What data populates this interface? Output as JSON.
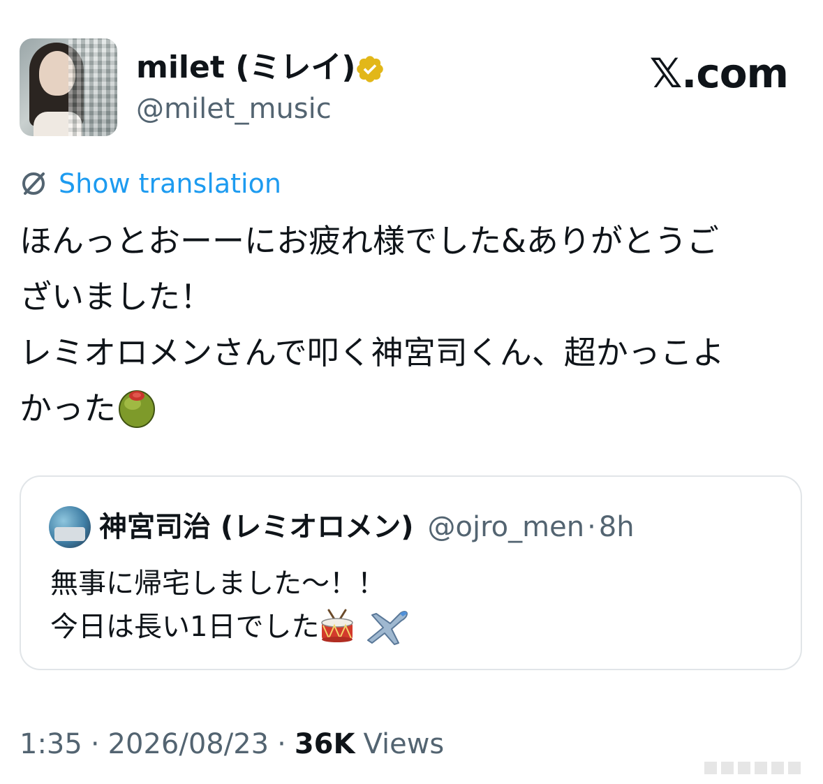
{
  "author": {
    "display_name": "milet (ミレイ)",
    "handle": "@milet_music",
    "verified": true
  },
  "site_brand": "𝕏.com",
  "translation": {
    "label": "Show translation"
  },
  "tweet": {
    "lines": [
      "ほんっとおーーにお疲れ様でした&ありがとうご",
      "ざいました！",
      "レミオロメンさんで叩く神宮司くん、超かっこよ",
      "かった"
    ],
    "trailing_emoji": "olive-icon"
  },
  "quote": {
    "name": "神宮司治 (レミオロメン)",
    "handle": "@ojro_men",
    "dot": "·",
    "time": "8h",
    "lines": [
      "無事に帰宅しました〜！！",
      "今日は長い1日でした"
    ],
    "emojis": [
      "drum-icon",
      "airplane-icon"
    ]
  },
  "meta": {
    "time": "1:35",
    "separator": "·",
    "date": "2026/08/23",
    "views_count": "36K",
    "views_label": "Views"
  },
  "colors": {
    "link": "#1d9bf0",
    "secondary_text": "#536471",
    "primary_text": "#0f1419",
    "verified_badge": "#e2b719",
    "card_border": "#e1e5e8"
  }
}
